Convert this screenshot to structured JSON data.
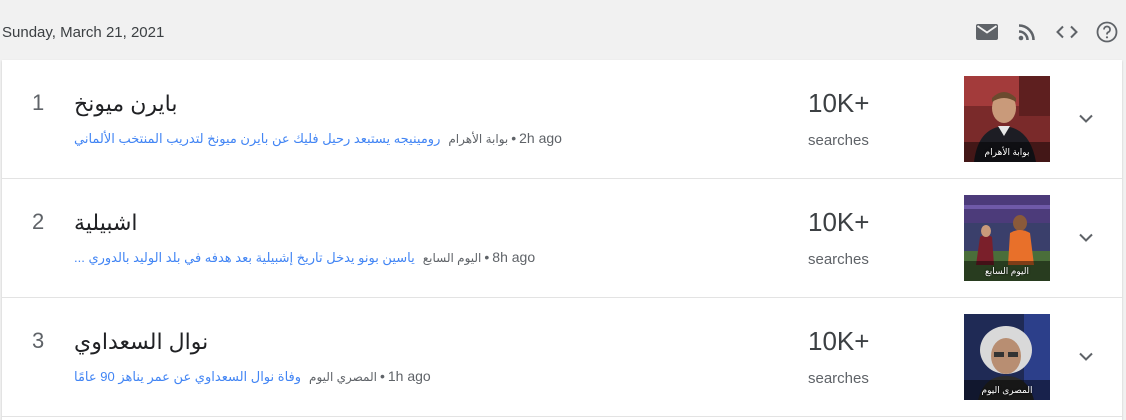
{
  "header": {
    "date": "Sunday, March 21, 2021",
    "toolbar": [
      "mail-icon",
      "rss-icon",
      "embed-code-icon",
      "help-icon"
    ]
  },
  "rows": [
    {
      "rank": "1",
      "title": "بايرن ميونخ",
      "article_link": "رومينيجه يستبعد رحيل فليك عن بايرن ميونخ لتدريب المنتخب الألماني",
      "source": "بوابة الأهرام",
      "time": "2h ago",
      "count": "10K+",
      "count_label": "searches",
      "thumb_caption": "بوابة الأهرام"
    },
    {
      "rank": "2",
      "title": "اشبيلية",
      "article_link": "ياسين بونو يدخل تاريخ إشبيلية بعد هدفه في بلد الوليد بالدوري ...",
      "source": "اليوم السابع",
      "time": "8h ago",
      "count": "10K+",
      "count_label": "searches",
      "thumb_caption": "اليوم السابع"
    },
    {
      "rank": "3",
      "title": "نوال السعداوي",
      "article_link": "وفاة نوال السعداوي عن عمر يناهز 90 عامًا",
      "source": "المصري اليوم",
      "time": "1h ago",
      "count": "10K+",
      "count_label": "searches",
      "thumb_caption": "المصرى اليوم"
    }
  ],
  "colors": {
    "link": "#4285f4",
    "text_primary": "#202124",
    "text_secondary": "#5f6368",
    "background": "#f1f1f1"
  }
}
